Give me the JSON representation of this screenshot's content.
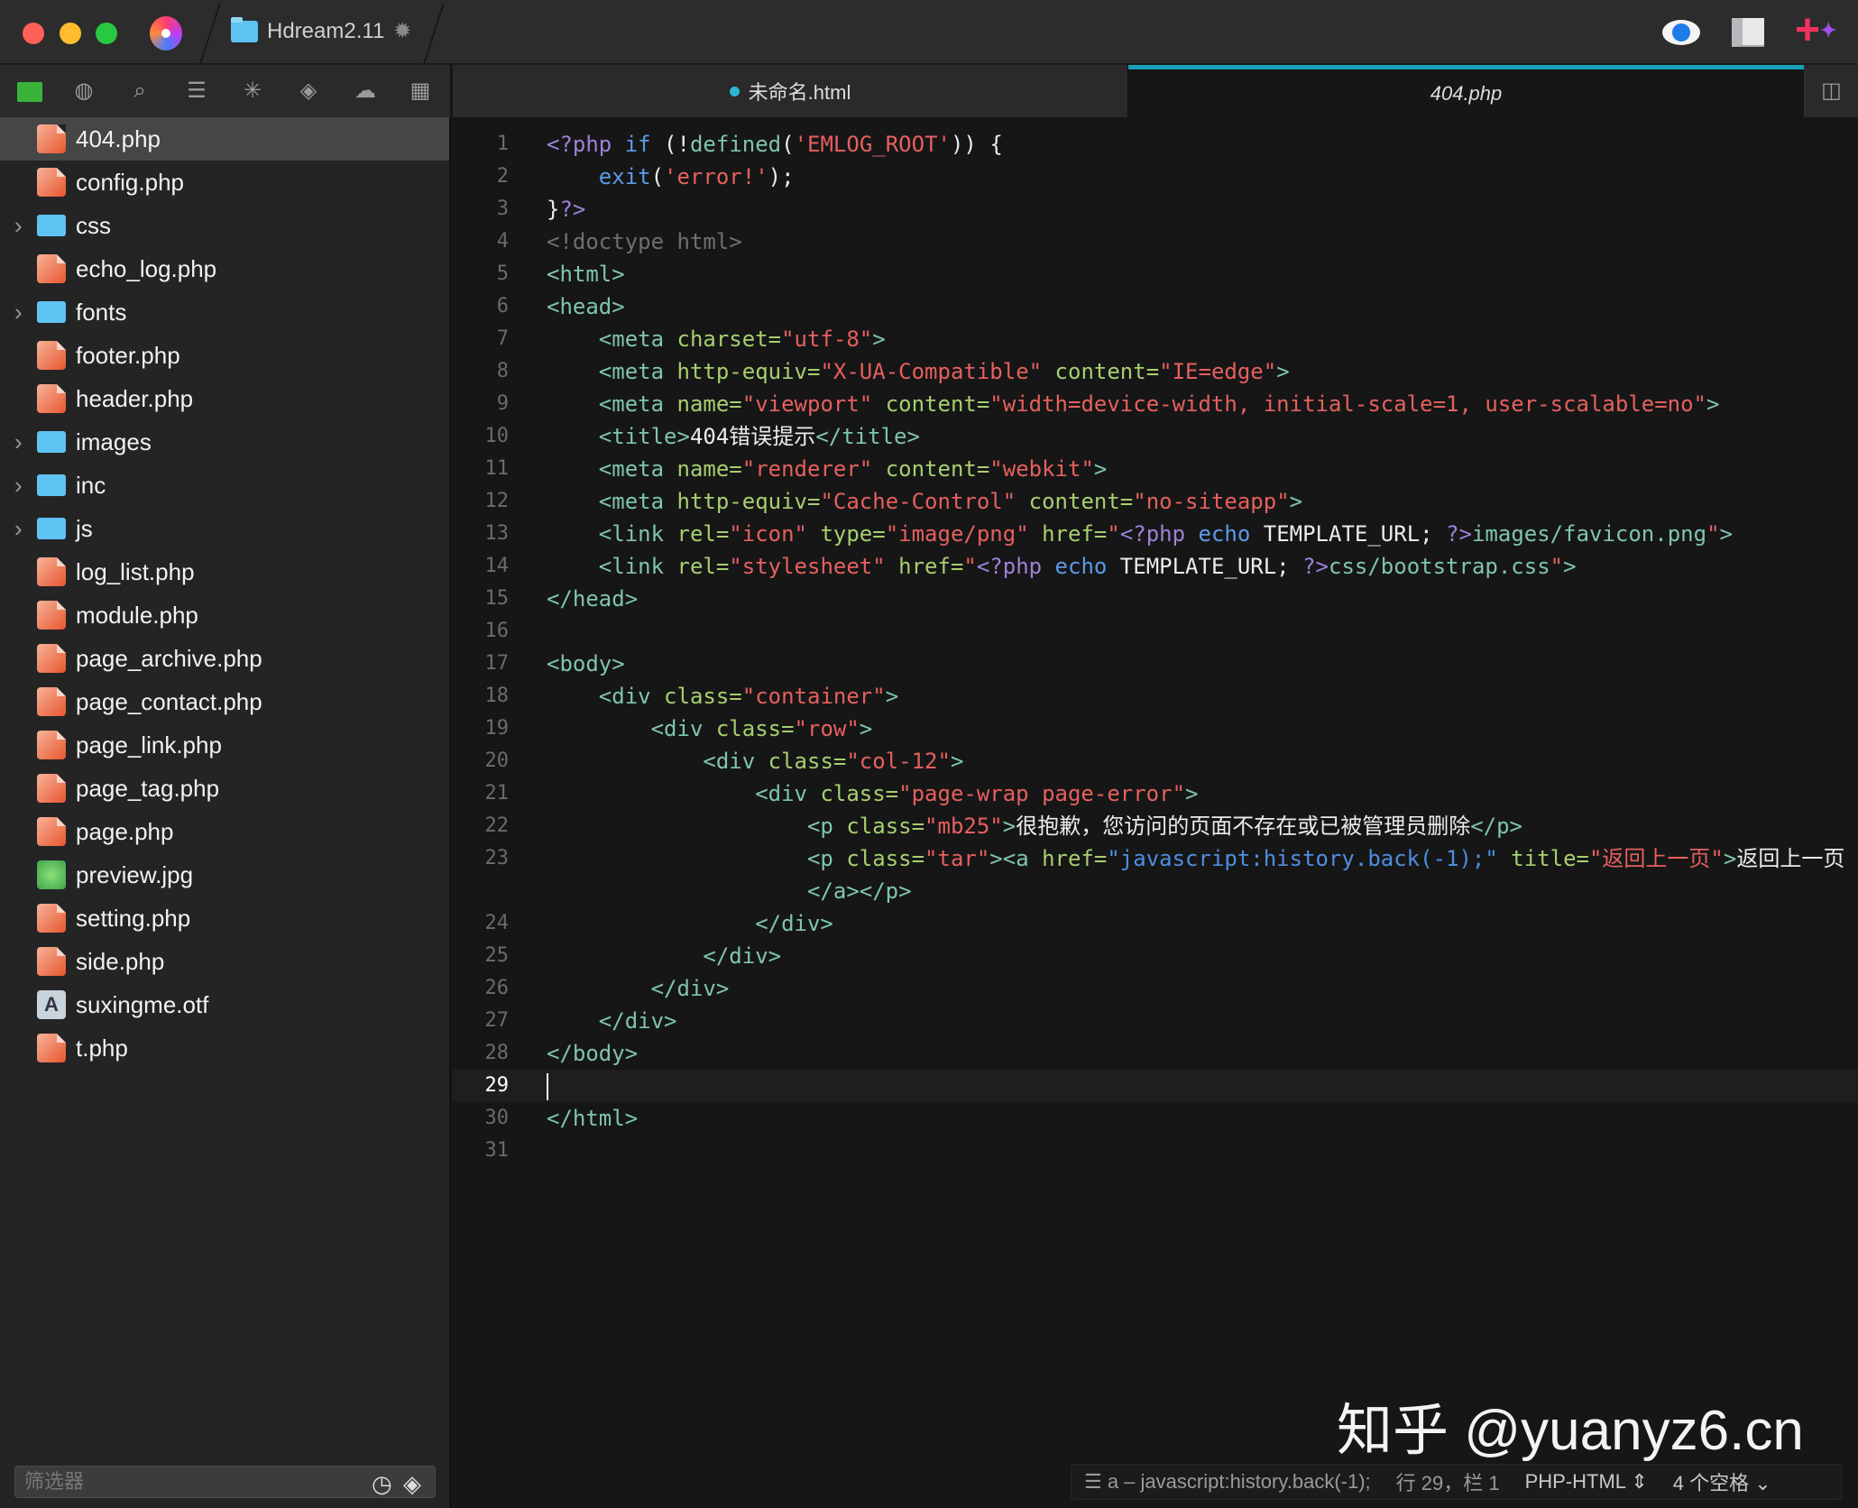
{
  "titlebar": {
    "project": "Hdream2.11"
  },
  "tabs": [
    {
      "label": "未命名.html",
      "modified": true
    },
    {
      "label": "404.php",
      "active": true
    }
  ],
  "files": [
    {
      "name": "404.php",
      "type": "php",
      "selected": true
    },
    {
      "name": "config.php",
      "type": "php"
    },
    {
      "name": "css",
      "type": "folder"
    },
    {
      "name": "echo_log.php",
      "type": "php"
    },
    {
      "name": "fonts",
      "type": "folder"
    },
    {
      "name": "footer.php",
      "type": "php"
    },
    {
      "name": "header.php",
      "type": "php"
    },
    {
      "name": "images",
      "type": "folder"
    },
    {
      "name": "inc",
      "type": "folder"
    },
    {
      "name": "js",
      "type": "folder"
    },
    {
      "name": "log_list.php",
      "type": "php"
    },
    {
      "name": "module.php",
      "type": "php"
    },
    {
      "name": "page_archive.php",
      "type": "php"
    },
    {
      "name": "page_contact.php",
      "type": "php"
    },
    {
      "name": "page_link.php",
      "type": "php"
    },
    {
      "name": "page_tag.php",
      "type": "php"
    },
    {
      "name": "page.php",
      "type": "php"
    },
    {
      "name": "preview.jpg",
      "type": "image"
    },
    {
      "name": "setting.php",
      "type": "php"
    },
    {
      "name": "side.php",
      "type": "php"
    },
    {
      "name": "suxingme.otf",
      "type": "font"
    },
    {
      "name": "t.php",
      "type": "php"
    }
  ],
  "filter": {
    "placeholder": "筛选器"
  },
  "code": {
    "current_line": "29",
    "lines": [
      {
        "n": "1",
        "segs": [
          [
            "p",
            "<?php"
          ],
          [
            "k",
            " if"
          ],
          [
            "w",
            " (!"
          ],
          [
            "t",
            "defined"
          ],
          [
            "w",
            "("
          ],
          [
            "s",
            "'EMLOG_ROOT'"
          ],
          [
            "w",
            ")) {"
          ]
        ]
      },
      {
        "n": "2",
        "segs": [
          [
            "w",
            "    "
          ],
          [
            "k",
            "exit"
          ],
          [
            "w",
            "("
          ],
          [
            "s",
            "'error!'"
          ],
          [
            "w",
            ");"
          ]
        ]
      },
      {
        "n": "3",
        "segs": [
          [
            "w",
            "}"
          ],
          [
            "p",
            "?>"
          ]
        ]
      },
      {
        "n": "4",
        "segs": [
          [
            "c",
            "<!doctype html>"
          ]
        ]
      },
      {
        "n": "5",
        "segs": [
          [
            "t",
            "<html>"
          ]
        ]
      },
      {
        "n": "6",
        "segs": [
          [
            "t",
            "<head>"
          ]
        ]
      },
      {
        "n": "7",
        "segs": [
          [
            "t",
            "    <meta "
          ],
          [
            "a",
            "charset="
          ],
          [
            "s",
            "\"utf-8\""
          ],
          [
            "t",
            ">"
          ]
        ]
      },
      {
        "n": "8",
        "segs": [
          [
            "t",
            "    <meta "
          ],
          [
            "a",
            "http-equiv="
          ],
          [
            "s",
            "\"X-UA-Compatible\""
          ],
          [
            "a",
            " content="
          ],
          [
            "s",
            "\"IE=edge\""
          ],
          [
            "t",
            ">"
          ]
        ]
      },
      {
        "n": "9",
        "segs": [
          [
            "t",
            "    <meta "
          ],
          [
            "a",
            "name="
          ],
          [
            "s",
            "\"viewport\""
          ],
          [
            "a",
            " content="
          ],
          [
            "s",
            "\"width=device-width, initial-scale=1, user-scalable=no\""
          ],
          [
            "t",
            ">"
          ]
        ]
      },
      {
        "n": "10",
        "segs": [
          [
            "t",
            "    <title>"
          ],
          [
            "w",
            "404错误提示"
          ],
          [
            "t",
            "</title>"
          ]
        ]
      },
      {
        "n": "11",
        "segs": [
          [
            "t",
            "    <meta "
          ],
          [
            "a",
            "name="
          ],
          [
            "s",
            "\"renderer\""
          ],
          [
            "a",
            " content="
          ],
          [
            "s",
            "\"webkit\""
          ],
          [
            "t",
            ">"
          ]
        ]
      },
      {
        "n": "12",
        "segs": [
          [
            "t",
            "    <meta "
          ],
          [
            "a",
            "http-equiv="
          ],
          [
            "s",
            "\"Cache-Control\""
          ],
          [
            "a",
            " content="
          ],
          [
            "s",
            "\"no-siteapp\""
          ],
          [
            "t",
            ">"
          ]
        ]
      },
      {
        "n": "13",
        "segs": [
          [
            "t",
            "    <link "
          ],
          [
            "a",
            "rel="
          ],
          [
            "s",
            "\"icon\""
          ],
          [
            "a",
            " type="
          ],
          [
            "s",
            "\"image/png\""
          ],
          [
            "a",
            " href="
          ],
          [
            "s",
            "\""
          ],
          [
            "p",
            "<?php"
          ],
          [
            "k",
            " echo"
          ],
          [
            "w",
            " TEMPLATE_URL; "
          ],
          [
            "p",
            "?>"
          ],
          [
            "t",
            "images/favicon.png"
          ],
          [
            "s",
            "\""
          ],
          [
            "t",
            ">"
          ]
        ]
      },
      {
        "n": "14",
        "segs": [
          [
            "t",
            "    <link "
          ],
          [
            "a",
            "rel="
          ],
          [
            "s",
            "\"stylesheet\""
          ],
          [
            "a",
            " href="
          ],
          [
            "s",
            "\""
          ],
          [
            "p",
            "<?php"
          ],
          [
            "k",
            " echo"
          ],
          [
            "w",
            " TEMPLATE_URL; "
          ],
          [
            "p",
            "?>"
          ],
          [
            "t",
            "css/bootstrap.css"
          ],
          [
            "s",
            "\""
          ],
          [
            "t",
            ">"
          ]
        ]
      },
      {
        "n": "15",
        "segs": [
          [
            "t",
            "</head>"
          ]
        ]
      },
      {
        "n": "16",
        "segs": []
      },
      {
        "n": "17",
        "segs": [
          [
            "t",
            "<body>"
          ]
        ]
      },
      {
        "n": "18",
        "segs": [
          [
            "t",
            "    <div "
          ],
          [
            "a",
            "class="
          ],
          [
            "s",
            "\"container\""
          ],
          [
            "t",
            ">"
          ]
        ]
      },
      {
        "n": "19",
        "segs": [
          [
            "t",
            "        <div "
          ],
          [
            "a",
            "class="
          ],
          [
            "s",
            "\"row\""
          ],
          [
            "t",
            ">"
          ]
        ]
      },
      {
        "n": "20",
        "segs": [
          [
            "t",
            "            <div "
          ],
          [
            "a",
            "class="
          ],
          [
            "s",
            "\"col-12\""
          ],
          [
            "t",
            ">"
          ]
        ]
      },
      {
        "n": "21",
        "segs": [
          [
            "t",
            "                <div "
          ],
          [
            "a",
            "class="
          ],
          [
            "s",
            "\"page-wrap page-error\""
          ],
          [
            "t",
            ">"
          ]
        ]
      },
      {
        "n": "22",
        "segs": [
          [
            "t",
            "                    <p "
          ],
          [
            "a",
            "class="
          ],
          [
            "s",
            "\"mb25\""
          ],
          [
            "t",
            ">"
          ],
          [
            "w",
            "很抱歉，您访问的页面不存在或已被管理员删除"
          ],
          [
            "t",
            "</p>"
          ]
        ]
      },
      {
        "n": "23",
        "segs": [
          [
            "t",
            "                    <p "
          ],
          [
            "a",
            "class="
          ],
          [
            "s",
            "\"tar\""
          ],
          [
            "t",
            "><a "
          ],
          [
            "a",
            "href="
          ],
          [
            "j",
            "\"javascript:history.back(-1);\""
          ],
          [
            "a",
            " title="
          ],
          [
            "s",
            "\"返回上一页\""
          ],
          [
            "t",
            ">"
          ],
          [
            "w",
            "返回上一页"
          ]
        ]
      },
      {
        "n": "",
        "segs": [
          [
            "t",
            "                    </a></p>"
          ]
        ]
      },
      {
        "n": "24",
        "segs": [
          [
            "t",
            "                </div>"
          ]
        ]
      },
      {
        "n": "25",
        "segs": [
          [
            "t",
            "            </div>"
          ]
        ]
      },
      {
        "n": "26",
        "segs": [
          [
            "t",
            "        </div>"
          ]
        ]
      },
      {
        "n": "27",
        "segs": [
          [
            "t",
            "    </div>"
          ]
        ]
      },
      {
        "n": "28",
        "segs": [
          [
            "t",
            "</body>"
          ]
        ]
      },
      {
        "n": "29",
        "segs": []
      },
      {
        "n": "30",
        "segs": [
          [
            "t",
            "</html>"
          ]
        ]
      },
      {
        "n": "31",
        "segs": []
      }
    ]
  },
  "watermark": "知乎 @yuanyz6.cn",
  "status": {
    "symbol": "a – javascript:history.back(-1);",
    "position": "行 29，栏 1",
    "syntax": "PHP-HTML",
    "indent": "4 个空格"
  },
  "colors": {
    "accent": "#1aa0b8",
    "tag": "#7fc4ae",
    "attr": "#a7cf6e",
    "string": "#e5605d",
    "php": "#9c82d6",
    "keyword": "#5c9ae8"
  }
}
